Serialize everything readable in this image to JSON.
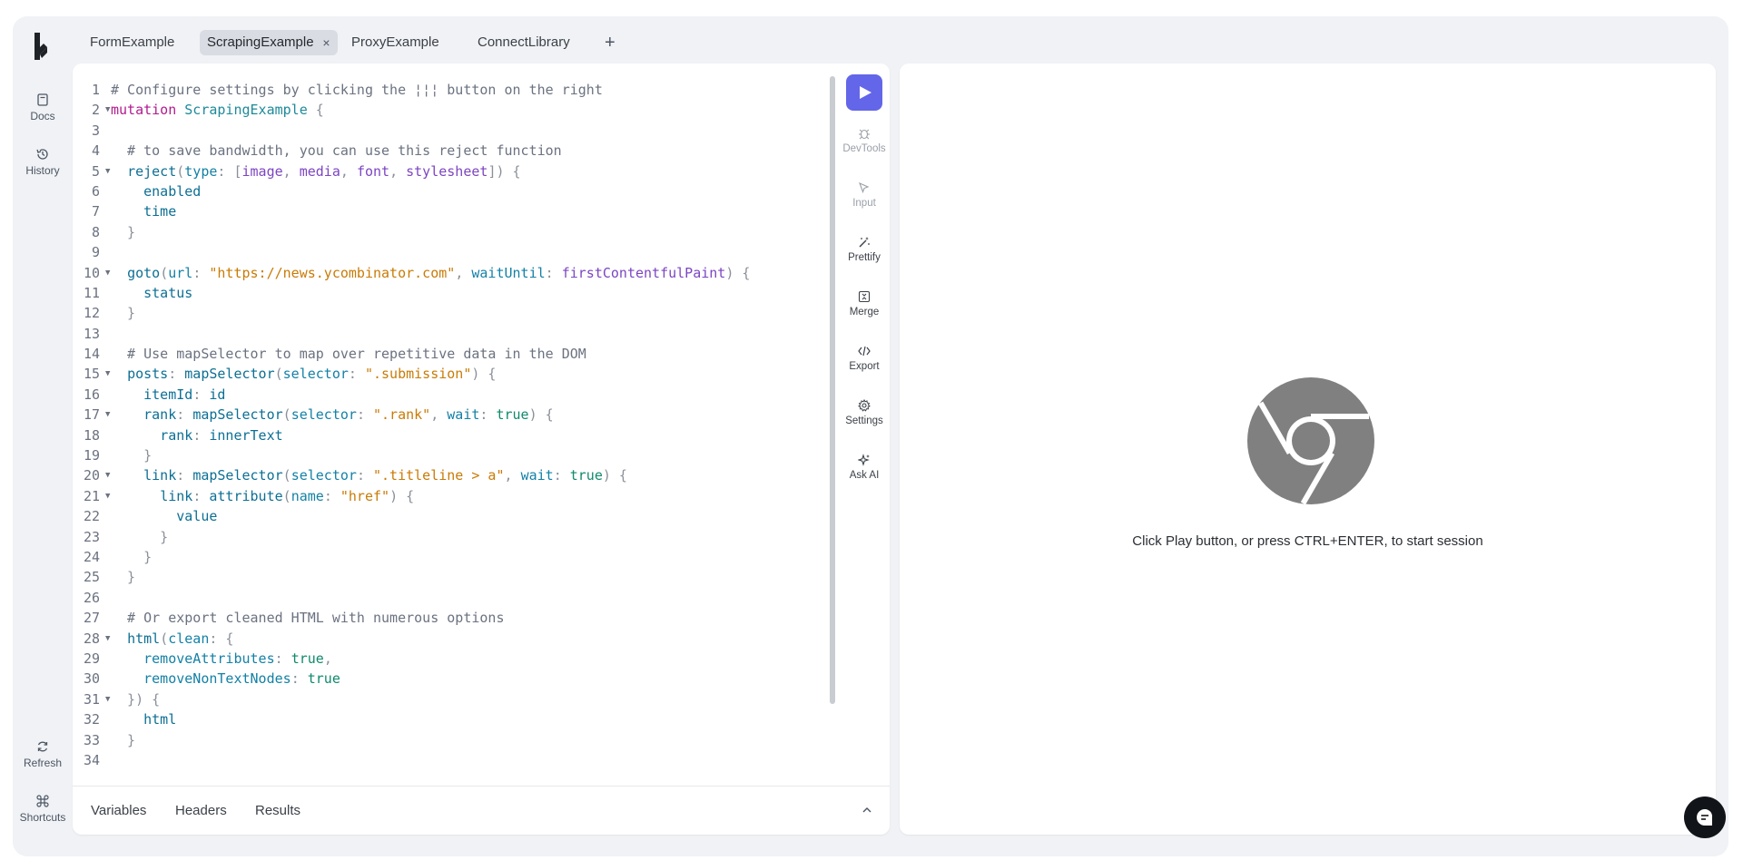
{
  "tabs": [
    {
      "label": "FormExample"
    },
    {
      "label": "ScrapingExample"
    },
    {
      "label": "ProxyExample"
    },
    {
      "label": "ConnectLibrary"
    }
  ],
  "active_tab_close": "×",
  "add_tab": "+",
  "left_rail": {
    "docs": "Docs",
    "history": "History",
    "refresh": "Refresh",
    "shortcuts": "Shortcuts"
  },
  "editor": {
    "lines": [
      [
        {
          "t": "# Configure settings by clicking the ¦¦¦ button on the right",
          "c": "comment"
        }
      ],
      [
        {
          "t": "mutation",
          "c": "kw"
        },
        {
          "t": " "
        },
        {
          "t": "ScrapingExample",
          "c": "def"
        },
        {
          "t": " {",
          "c": "punc"
        }
      ],
      [],
      [
        {
          "t": "  # to save bandwidth, you can use this reject function",
          "c": "comment"
        }
      ],
      [
        {
          "t": "  "
        },
        {
          "t": "reject",
          "c": "field"
        },
        {
          "t": "(",
          "c": "punc"
        },
        {
          "t": "type",
          "c": "arg"
        },
        {
          "t": ": [",
          "c": "punc"
        },
        {
          "t": "image",
          "c": "enum"
        },
        {
          "t": ", ",
          "c": "punc"
        },
        {
          "t": "media",
          "c": "enum"
        },
        {
          "t": ", ",
          "c": "punc"
        },
        {
          "t": "font",
          "c": "enum"
        },
        {
          "t": ", ",
          "c": "punc"
        },
        {
          "t": "stylesheet",
          "c": "enum"
        },
        {
          "t": "]) {",
          "c": "punc"
        }
      ],
      [
        {
          "t": "    "
        },
        {
          "t": "enabled",
          "c": "field"
        }
      ],
      [
        {
          "t": "    "
        },
        {
          "t": "time",
          "c": "field"
        }
      ],
      [
        {
          "t": "  }",
          "c": "punc"
        }
      ],
      [],
      [
        {
          "t": "  "
        },
        {
          "t": "goto",
          "c": "field"
        },
        {
          "t": "(",
          "c": "punc"
        },
        {
          "t": "url",
          "c": "arg"
        },
        {
          "t": ": ",
          "c": "punc"
        },
        {
          "t": "\"https://news.ycombinator.com\"",
          "c": "str"
        },
        {
          "t": ", ",
          "c": "punc"
        },
        {
          "t": "waitUntil",
          "c": "arg"
        },
        {
          "t": ": ",
          "c": "punc"
        },
        {
          "t": "firstContentfulPaint",
          "c": "enum"
        },
        {
          "t": ") {",
          "c": "punc"
        }
      ],
      [
        {
          "t": "    "
        },
        {
          "t": "status",
          "c": "field"
        }
      ],
      [
        {
          "t": "  }",
          "c": "punc"
        }
      ],
      [],
      [
        {
          "t": "  # Use mapSelector to map over repetitive data in the DOM",
          "c": "comment"
        }
      ],
      [
        {
          "t": "  "
        },
        {
          "t": "posts",
          "c": "field"
        },
        {
          "t": ": ",
          "c": "punc"
        },
        {
          "t": "mapSelector",
          "c": "field"
        },
        {
          "t": "(",
          "c": "punc"
        },
        {
          "t": "selector",
          "c": "arg"
        },
        {
          "t": ": ",
          "c": "punc"
        },
        {
          "t": "\".submission\"",
          "c": "str"
        },
        {
          "t": ") {",
          "c": "punc"
        }
      ],
      [
        {
          "t": "    "
        },
        {
          "t": "itemId",
          "c": "field"
        },
        {
          "t": ": ",
          "c": "punc"
        },
        {
          "t": "id",
          "c": "field"
        }
      ],
      [
        {
          "t": "    "
        },
        {
          "t": "rank",
          "c": "field"
        },
        {
          "t": ": ",
          "c": "punc"
        },
        {
          "t": "mapSelector",
          "c": "field"
        },
        {
          "t": "(",
          "c": "punc"
        },
        {
          "t": "selector",
          "c": "arg"
        },
        {
          "t": ": ",
          "c": "punc"
        },
        {
          "t": "\".rank\"",
          "c": "str"
        },
        {
          "t": ", ",
          "c": "punc"
        },
        {
          "t": "wait",
          "c": "arg"
        },
        {
          "t": ": ",
          "c": "punc"
        },
        {
          "t": "true",
          "c": "bool"
        },
        {
          "t": ") {",
          "c": "punc"
        }
      ],
      [
        {
          "t": "      "
        },
        {
          "t": "rank",
          "c": "field"
        },
        {
          "t": ": ",
          "c": "punc"
        },
        {
          "t": "innerText",
          "c": "field"
        }
      ],
      [
        {
          "t": "    }",
          "c": "punc"
        }
      ],
      [
        {
          "t": "    "
        },
        {
          "t": "link",
          "c": "field"
        },
        {
          "t": ": ",
          "c": "punc"
        },
        {
          "t": "mapSelector",
          "c": "field"
        },
        {
          "t": "(",
          "c": "punc"
        },
        {
          "t": "selector",
          "c": "arg"
        },
        {
          "t": ": ",
          "c": "punc"
        },
        {
          "t": "\".titleline > a\"",
          "c": "str"
        },
        {
          "t": ", ",
          "c": "punc"
        },
        {
          "t": "wait",
          "c": "arg"
        },
        {
          "t": ": ",
          "c": "punc"
        },
        {
          "t": "true",
          "c": "bool"
        },
        {
          "t": ") {",
          "c": "punc"
        }
      ],
      [
        {
          "t": "      "
        },
        {
          "t": "link",
          "c": "field"
        },
        {
          "t": ": ",
          "c": "punc"
        },
        {
          "t": "attribute",
          "c": "field"
        },
        {
          "t": "(",
          "c": "punc"
        },
        {
          "t": "name",
          "c": "arg"
        },
        {
          "t": ": ",
          "c": "punc"
        },
        {
          "t": "\"href\"",
          "c": "str"
        },
        {
          "t": ") {",
          "c": "punc"
        }
      ],
      [
        {
          "t": "        "
        },
        {
          "t": "value",
          "c": "field"
        }
      ],
      [
        {
          "t": "      }",
          "c": "punc"
        }
      ],
      [
        {
          "t": "    }",
          "c": "punc"
        }
      ],
      [
        {
          "t": "  }",
          "c": "punc"
        }
      ],
      [],
      [
        {
          "t": "  # Or export cleaned HTML with numerous options",
          "c": "comment"
        }
      ],
      [
        {
          "t": "  "
        },
        {
          "t": "html",
          "c": "field"
        },
        {
          "t": "(",
          "c": "punc"
        },
        {
          "t": "clean",
          "c": "arg"
        },
        {
          "t": ": {",
          "c": "punc"
        }
      ],
      [
        {
          "t": "    "
        },
        {
          "t": "removeAttributes",
          "c": "arg"
        },
        {
          "t": ": ",
          "c": "punc"
        },
        {
          "t": "true",
          "c": "bool"
        },
        {
          "t": ",",
          "c": "punc"
        }
      ],
      [
        {
          "t": "    "
        },
        {
          "t": "removeNonTextNodes",
          "c": "arg"
        },
        {
          "t": ": ",
          "c": "punc"
        },
        {
          "t": "true",
          "c": "bool"
        }
      ],
      [
        {
          "t": "  }) {",
          "c": "punc"
        }
      ],
      [
        {
          "t": "    "
        },
        {
          "t": "html",
          "c": "field"
        }
      ],
      [
        {
          "t": "  }",
          "c": "punc"
        }
      ],
      []
    ],
    "foldable_lines": [
      2,
      5,
      10,
      15,
      17,
      20,
      21,
      28,
      31
    ]
  },
  "toolbar": {
    "devtools": "DevTools",
    "input": "Input",
    "prettify": "Prettify",
    "merge": "Merge",
    "export": "Export",
    "settings": "Settings",
    "ask_ai": "Ask AI"
  },
  "bottom_tabs": {
    "variables": "Variables",
    "headers": "Headers",
    "results": "Results"
  },
  "preview": {
    "message": "Click Play button, or press CTRL+ENTER, to start session"
  },
  "colors": {
    "accent": "#6366e8",
    "background": "#f0f2f5"
  }
}
